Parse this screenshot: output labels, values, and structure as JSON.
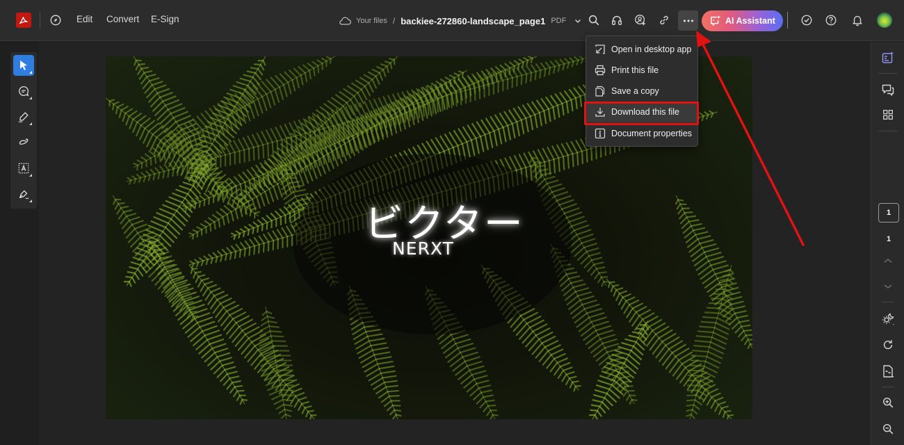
{
  "app": {
    "name": "Adobe Acrobat",
    "brand_color": "#c1180f",
    "accent_color": "#2f7de1"
  },
  "topbar": {
    "nav": [
      {
        "label": "Edit"
      },
      {
        "label": "Convert"
      },
      {
        "label": "E-Sign"
      }
    ],
    "breadcrumb": {
      "root": "Your files",
      "separator": "/",
      "filename": "backiee-272860-landscape_page1",
      "filetype": "PDF"
    },
    "icons": [
      "search-icon",
      "headphones-icon",
      "share-user-icon",
      "link-icon",
      "more-icon"
    ],
    "ai_assistant": {
      "label": "AI Assistant"
    },
    "right_icons": [
      "checkmark-circle-icon",
      "help-icon",
      "bell-icon",
      "avatar"
    ]
  },
  "more_menu": {
    "items": [
      {
        "label": "Open in desktop app",
        "icon": "open-external-icon"
      },
      {
        "label": "Print this file",
        "icon": "printer-icon"
      },
      {
        "label": "Save a copy",
        "icon": "copy-icon"
      },
      {
        "label": "Download this file",
        "icon": "download-icon",
        "highlighted": true
      },
      {
        "label": "Document properties",
        "icon": "info-icon"
      }
    ]
  },
  "left_tools": [
    {
      "name": "select-tool",
      "active": true
    },
    {
      "name": "comment-tool"
    },
    {
      "name": "highlight-tool"
    },
    {
      "name": "draw-tool"
    },
    {
      "name": "text-tool"
    },
    {
      "name": "sign-tool"
    }
  ],
  "document": {
    "title_jp": "ビクター",
    "title_en": "NERXT"
  },
  "right_rail": {
    "current_page": "1",
    "total_pages": "1"
  },
  "annotation": {
    "color": "#e01212",
    "highlight_target": "Download this file"
  }
}
